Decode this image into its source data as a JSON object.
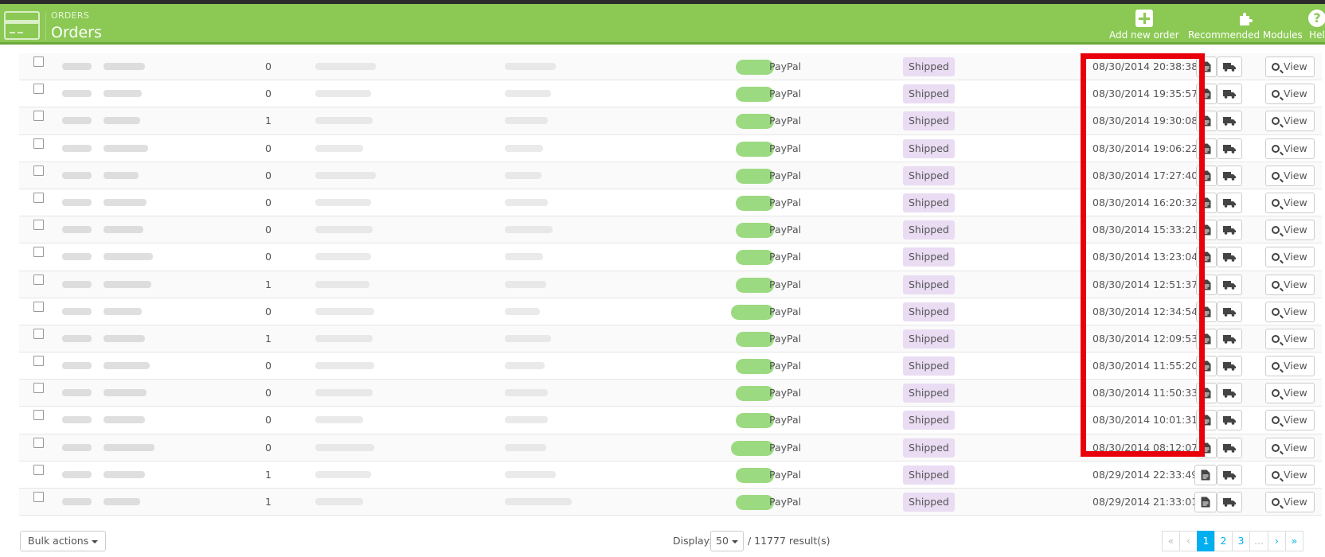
{
  "header": {
    "breadcrumb": "ORDERS",
    "title": "Orders",
    "toolbar": [
      {
        "label": "Add new order",
        "icon": "plus-square-icon"
      },
      {
        "label": "Recommended Modules",
        "icon": "puzzle-icon"
      },
      {
        "label": "Hel",
        "icon": "help-icon"
      }
    ]
  },
  "orders": [
    {
      "new": "0",
      "payment": "PayPal",
      "status": "Shipped",
      "date": "08/30/2014 20:38:38",
      "view": "View"
    },
    {
      "new": "0",
      "payment": "PayPal",
      "status": "Shipped",
      "date": "08/30/2014 19:35:57",
      "view": "View"
    },
    {
      "new": "1",
      "payment": "PayPal",
      "status": "Shipped",
      "date": "08/30/2014 19:30:08",
      "view": "View"
    },
    {
      "new": "0",
      "payment": "PayPal",
      "status": "Shipped",
      "date": "08/30/2014 19:06:22",
      "view": "View"
    },
    {
      "new": "0",
      "payment": "PayPal",
      "status": "Shipped",
      "date": "08/30/2014 17:27:40",
      "view": "View"
    },
    {
      "new": "0",
      "payment": "PayPal",
      "status": "Shipped",
      "date": "08/30/2014 16:20:32",
      "view": "View"
    },
    {
      "new": "0",
      "payment": "PayPal",
      "status": "Shipped",
      "date": "08/30/2014 15:33:21",
      "view": "View"
    },
    {
      "new": "0",
      "payment": "PayPal",
      "status": "Shipped",
      "date": "08/30/2014 13:23:04",
      "view": "View"
    },
    {
      "new": "1",
      "payment": "PayPal",
      "status": "Shipped",
      "date": "08/30/2014 12:51:37",
      "view": "View"
    },
    {
      "new": "0",
      "payment": "PayPal",
      "status": "Shipped",
      "date": "08/30/2014 12:34:54",
      "view": "View"
    },
    {
      "new": "1",
      "payment": "PayPal",
      "status": "Shipped",
      "date": "08/30/2014 12:09:53",
      "view": "View"
    },
    {
      "new": "0",
      "payment": "PayPal",
      "status": "Shipped",
      "date": "08/30/2014 11:55:20",
      "view": "View"
    },
    {
      "new": "0",
      "payment": "PayPal",
      "status": "Shipped",
      "date": "08/30/2014 11:50:33",
      "view": "View"
    },
    {
      "new": "0",
      "payment": "PayPal",
      "status": "Shipped",
      "date": "08/30/2014 10:01:31",
      "view": "View"
    },
    {
      "new": "0",
      "payment": "PayPal",
      "status": "Shipped",
      "date": "08/30/2014 08:12:07",
      "view": "View"
    },
    {
      "new": "1",
      "payment": "PayPal",
      "status": "Shipped",
      "date": "08/29/2014 22:33:49",
      "view": "View"
    },
    {
      "new": "1",
      "payment": "PayPal",
      "status": "Shipped",
      "date": "08/29/2014 21:33:01",
      "view": "View"
    }
  ],
  "footer": {
    "bulk_actions": "Bulk actions",
    "display_label": "Display:",
    "display_value": "50",
    "results": "/ 11777 result(s)",
    "pagination": [
      "«",
      "‹",
      "1",
      "2",
      "3",
      "...",
      "›",
      "»"
    ]
  },
  "colors": {
    "header_bg": "#8bc954",
    "status_badge_bg": "#e9dcf3",
    "highlight_border": "#e8000b",
    "pagination_active": "#00aff0"
  }
}
